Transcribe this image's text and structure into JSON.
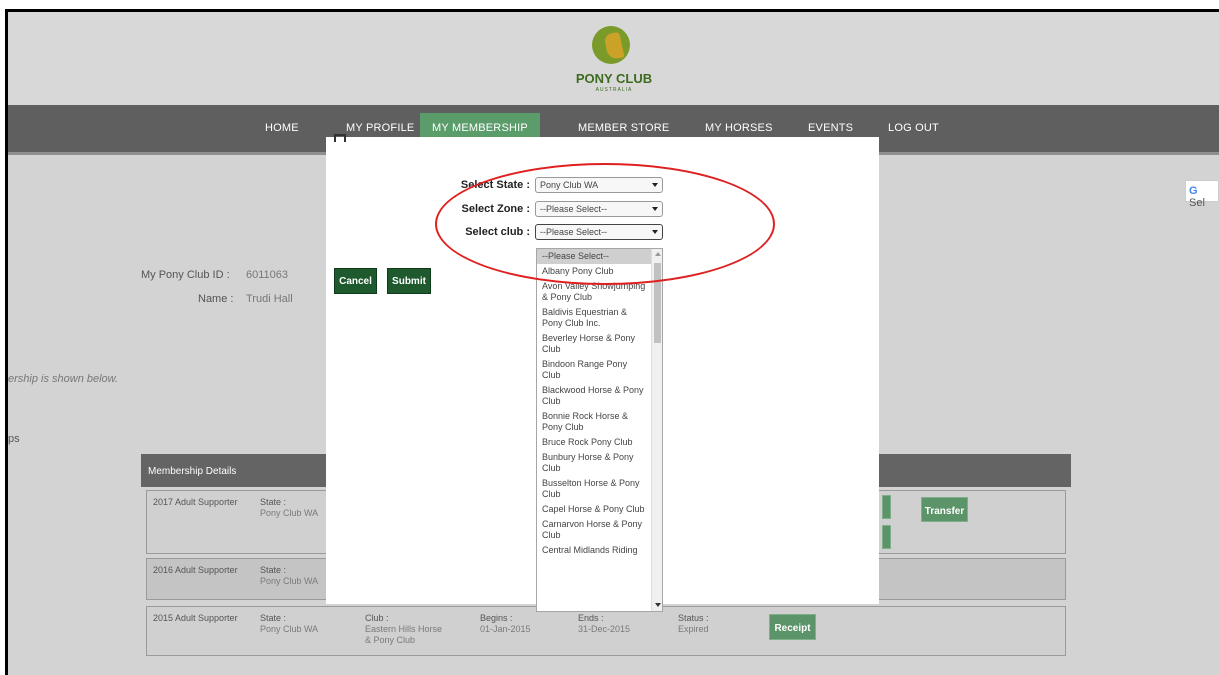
{
  "header": {
    "logo_text": "PONY CLUB",
    "logo_subtext": "AUSTRALIA"
  },
  "nav": {
    "items": [
      {
        "label": "HOME"
      },
      {
        "label": "MY PROFILE"
      },
      {
        "label": "MY MEMBERSHIP"
      },
      {
        "label": "MEMBER STORE"
      },
      {
        "label": "MY HORSES"
      },
      {
        "label": "EVENTS"
      },
      {
        "label": "LOG OUT"
      }
    ]
  },
  "translate": {
    "label": "Sel"
  },
  "profile": {
    "id_label": "My Pony Club ID :",
    "id_value": "6011063",
    "name_label": "Name :",
    "name_value": "Trudi Hall"
  },
  "side": {
    "note": "ership is shown below.",
    "ps": "ps"
  },
  "details": {
    "header": "Membership Details",
    "rows": [
      {
        "type": "2017 Adult Supporter",
        "state_label": "State :",
        "state_value": "Pony Club WA",
        "btn_transfer": "Transfer"
      },
      {
        "type": "2016 Adult Supporter",
        "state_label": "State :",
        "state_value": "Pony Club WA"
      },
      {
        "type": "2015 Adult Supporter",
        "state_label": "State :",
        "state_value": "Pony Club WA",
        "club_label": "Club :",
        "club_value": "Eastern Hills Horse & Pony Club",
        "begins_label": "Begins :",
        "begins_value": "01-Jan-2015",
        "ends_label": "Ends :",
        "ends_value": "31-Dec-2015",
        "status_label": "Status :",
        "status_value": "Expired",
        "btn_receipt": "Receipt"
      }
    ]
  },
  "modal": {
    "state_label": "Select State :",
    "state_value": "Pony Club WA",
    "zone_label": "Select Zone :",
    "zone_value": "--Please Select--",
    "club_label": "Select club :",
    "club_value": "--Please Select--",
    "cancel": "Cancel",
    "submit": "Submit",
    "club_options": [
      "--Please Select--",
      "Albany Pony Club",
      "Avon Valley Showjumping & Pony Club",
      "Baldivis Equestrian & Pony Club Inc.",
      "Beverley Horse & Pony Club",
      "Bindoon Range Pony Club",
      "Blackwood Horse & Pony Club",
      "Bonnie Rock Horse & Pony Club",
      "Bruce Rock Pony Club",
      "Bunbury Horse & Pony Club",
      "Busselton Horse & Pony Club",
      "Capel Horse & Pony Club",
      "Carnarvon Horse & Pony Club",
      "Central Midlands Riding"
    ]
  },
  "colors": {
    "annotation": "#e02020",
    "brand_green": "#1e5a2e",
    "nav_active": "#5b9c6b"
  }
}
